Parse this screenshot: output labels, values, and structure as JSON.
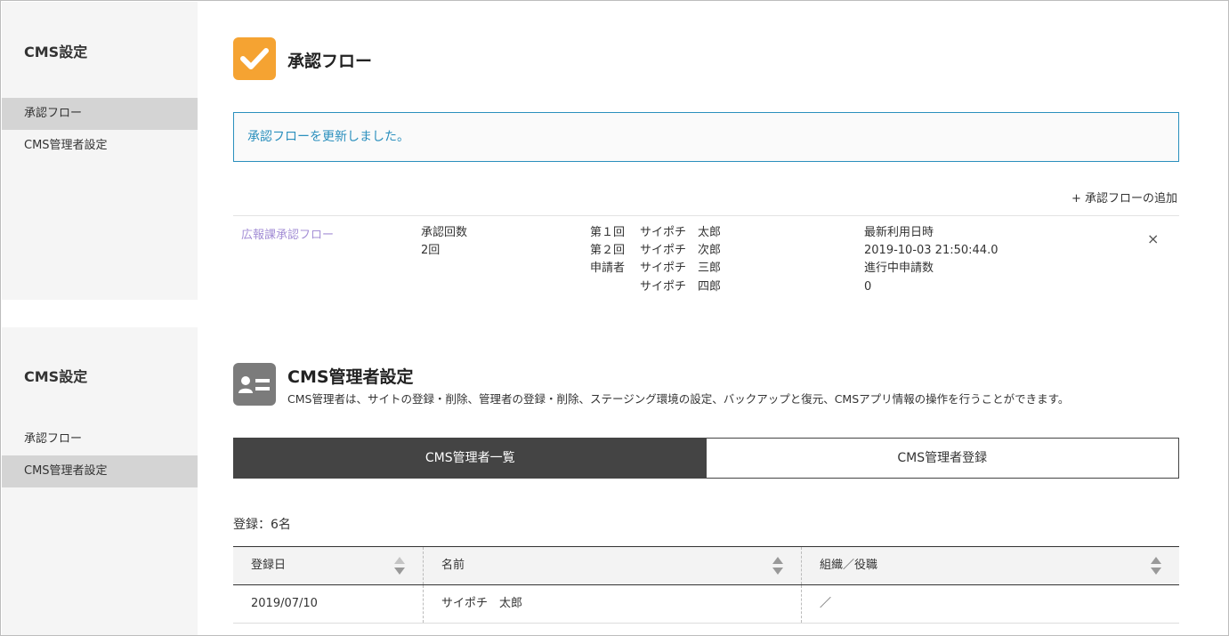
{
  "sidebar1": {
    "title": "CMS設定",
    "items": [
      {
        "label": "承認フロー",
        "active": true
      },
      {
        "label": "CMS管理者設定",
        "active": false
      }
    ]
  },
  "approval": {
    "title": "承認フロー",
    "notice": "承認フローを更新しました。",
    "add_link": "+ 承認フローの追加",
    "flow": {
      "name": "広報課承認フロー",
      "count_label": "承認回数",
      "count_value": "2回",
      "steps": [
        {
          "label": "第１回",
          "user": "サイポチ　太郎"
        },
        {
          "label": "第２回",
          "user": "サイポチ　次郎"
        },
        {
          "label": "申請者",
          "user": "サイポチ　三郎"
        },
        {
          "label": "",
          "user": "サイポチ　四郎"
        }
      ],
      "last_used_label": "最新利用日時",
      "last_used_value": "2019-10-03 21:50:44.0",
      "in_progress_label": "進行中申請数",
      "in_progress_value": "0",
      "delete_symbol": "×"
    }
  },
  "sidebar2": {
    "title": "CMS設定",
    "items": [
      {
        "label": "承認フロー",
        "active": false
      },
      {
        "label": "CMS管理者設定",
        "active": true
      }
    ]
  },
  "admin": {
    "title": "CMS管理者設定",
    "description": "CMS管理者は、サイトの登録・削除、管理者の登録・削除、ステージング環境の設定、バックアップと復元、CMSアプリ情報の操作を行うことができます。",
    "tabs": [
      {
        "label": "CMS管理者一覧",
        "active": true
      },
      {
        "label": "CMS管理者登録",
        "active": false
      }
    ],
    "count_text": "登録：6名",
    "table": {
      "headers": [
        "登録日",
        "名前",
        "組織／役職"
      ],
      "rows": [
        [
          "2019/07/10",
          "サイポチ　太郎",
          "／"
        ]
      ]
    }
  },
  "colors": {
    "accent_orange": "#f5a332",
    "notice_blue": "#2a8fbd",
    "link_purple": "#a48fd6",
    "tab_dark": "#444444"
  }
}
